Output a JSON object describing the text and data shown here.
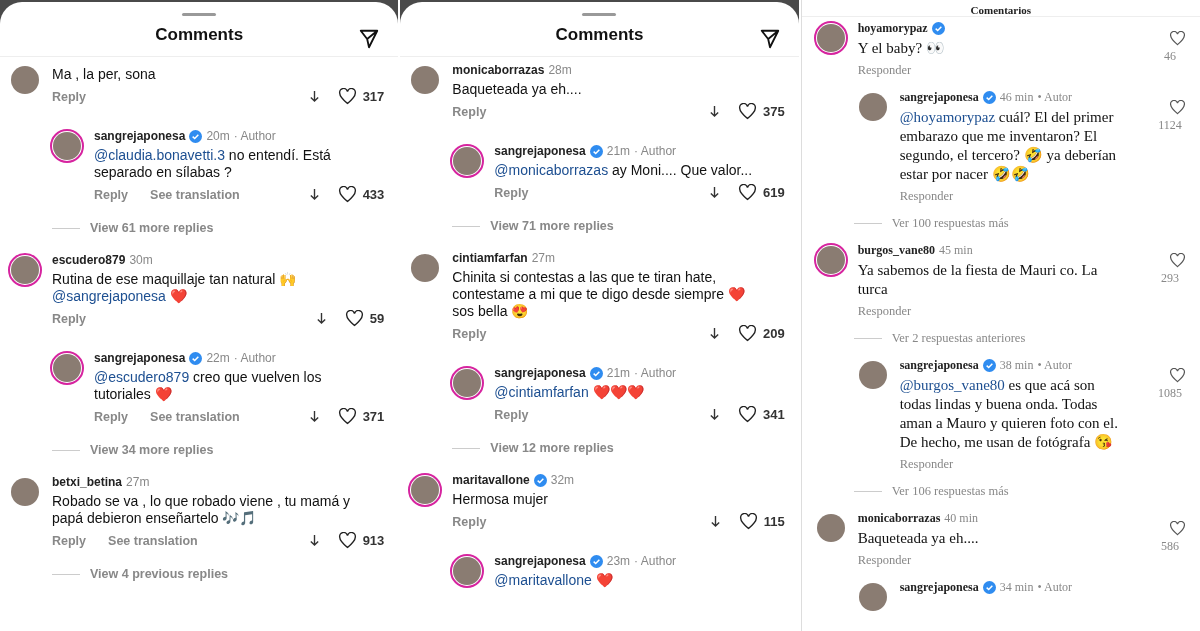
{
  "panels": [
    {
      "kind": "sheet",
      "title": "Comments",
      "items": [
        {
          "kind": "comment",
          "ring": false,
          "body": [
            {
              "kind": "plain",
              "text": "Ma , la per, sona"
            }
          ],
          "reply": "Reply",
          "likes": "317"
        },
        {
          "kind": "reply",
          "user": "sangrejaponesa",
          "verified": true,
          "ring": true,
          "time": "20m",
          "tag": "· Author",
          "body": [
            {
              "kind": "mention",
              "text": "@claudia.bonavetti.3"
            },
            {
              "kind": "plain",
              "text": " no entendí. Está separado en sílabas ?"
            }
          ],
          "reply": "Reply",
          "translate": "See translation",
          "likes": "433"
        },
        {
          "kind": "more",
          "text": "View 61 more replies"
        },
        {
          "kind": "comment",
          "user": "escudero879",
          "verified": false,
          "ring": true,
          "time": "30m",
          "body": [
            {
              "kind": "plain",
              "text": "Rutina de ese maquillaje tan natural 🙌 "
            },
            {
              "kind": "mention",
              "text": "@sangrejaponesa"
            },
            {
              "kind": "plain",
              "text": " ❤️"
            }
          ],
          "reply": "Reply",
          "likes": "59"
        },
        {
          "kind": "reply",
          "user": "sangrejaponesa",
          "verified": true,
          "ring": true,
          "time": "22m",
          "tag": "· Author",
          "body": [
            {
              "kind": "mention",
              "text": "@escudero879"
            },
            {
              "kind": "plain",
              "text": " creo que vuelven los tutoriales ❤️"
            }
          ],
          "reply": "Reply",
          "translate": "See translation",
          "likes": "371"
        },
        {
          "kind": "more",
          "text": "View 34 more replies"
        },
        {
          "kind": "comment",
          "user": "betxi_betina",
          "verified": false,
          "ring": false,
          "time": "27m",
          "body": [
            {
              "kind": "plain",
              "text": "Robado se va , lo que robado viene , tu mamá y papá debieron enseñartelo 🎶🎵"
            }
          ],
          "reply": "Reply",
          "translate": "See translation",
          "likes": "913"
        },
        {
          "kind": "more",
          "text": "View 4 previous replies"
        }
      ]
    },
    {
      "kind": "sheet",
      "title": "Comments",
      "items": [
        {
          "kind": "comment",
          "user": "monicaborrazas",
          "verified": false,
          "ring": false,
          "time": "28m",
          "body": [
            {
              "kind": "plain",
              "text": "Baqueteada ya eh...."
            }
          ],
          "reply": "Reply",
          "likes": "375"
        },
        {
          "kind": "reply",
          "user": "sangrejaponesa",
          "verified": true,
          "ring": true,
          "time": "21m",
          "tag": "· Author",
          "body": [
            {
              "kind": "mention",
              "text": "@monicaborrazas"
            },
            {
              "kind": "plain",
              "text": " ay Moni.... Que valor..."
            }
          ],
          "reply": "Reply",
          "likes": "619"
        },
        {
          "kind": "more",
          "text": "View 71 more replies"
        },
        {
          "kind": "comment",
          "user": "cintiamfarfan",
          "verified": false,
          "ring": false,
          "time": "27m",
          "body": [
            {
              "kind": "plain",
              "text": "Chinita si contestas a las que te tiran hate, contestame a mi que te digo desde siempre ❤️ sos bella 😍"
            }
          ],
          "reply": "Reply",
          "likes": "209"
        },
        {
          "kind": "reply",
          "user": "sangrejaponesa",
          "verified": true,
          "ring": true,
          "time": "21m",
          "tag": "· Author",
          "body": [
            {
              "kind": "mention",
              "text": "@cintiamfarfan"
            },
            {
              "kind": "plain",
              "text": " ❤️❤️❤️"
            }
          ],
          "reply": "Reply",
          "likes": "341"
        },
        {
          "kind": "more",
          "text": "View 12 more replies"
        },
        {
          "kind": "comment",
          "user": "maritavallone",
          "verified": true,
          "ring": true,
          "time": "32m",
          "body": [
            {
              "kind": "plain",
              "text": "Hermosa mujer"
            }
          ],
          "reply": "Reply",
          "likes": "115"
        },
        {
          "kind": "reply",
          "user": "sangrejaponesa",
          "verified": true,
          "ring": true,
          "time": "23m",
          "tag": "· Author",
          "body": [
            {
              "kind": "mention",
              "text": "@maritavallone"
            },
            {
              "kind": "plain",
              "text": " ❤️"
            }
          ]
        }
      ]
    },
    {
      "kind": "list",
      "title": "Comentarios",
      "items": [
        {
          "kind": "comment",
          "user": "hoyamorypaz",
          "verified": true,
          "ring": true,
          "body": [
            {
              "kind": "plain",
              "text": "Y el baby? 👀"
            }
          ],
          "reply": "Responder",
          "likes": "46"
        },
        {
          "kind": "reply",
          "user": "sangrejaponesa",
          "verified": true,
          "ring": false,
          "time": "46 min",
          "tag": "• Autor",
          "body": [
            {
              "kind": "mention",
              "text": "@hoyamorypaz"
            },
            {
              "kind": "plain",
              "text": " cuál? El del primer embarazo que me inventaron? El segundo, el tercero? 🤣 ya deberían estar por nacer 🤣🤣"
            }
          ],
          "reply": "Responder",
          "likes": "1124"
        },
        {
          "kind": "more",
          "text": "Ver 100 respuestas más"
        },
        {
          "kind": "comment",
          "user": "burgos_vane80",
          "verified": false,
          "ring": true,
          "time": "45 min",
          "body": [
            {
              "kind": "plain",
              "text": "Ya sabemos de la fiesta de Mauri co. La turca"
            }
          ],
          "reply": "Responder",
          "likes": "293"
        },
        {
          "kind": "more",
          "text": "Ver 2 respuestas anteriores"
        },
        {
          "kind": "reply",
          "user": "sangrejaponesa",
          "verified": true,
          "ring": false,
          "time": "38 min",
          "tag": "• Autor",
          "body": [
            {
              "kind": "mention",
              "text": "@burgos_vane80"
            },
            {
              "kind": "plain",
              "text": " es que acá son todas lindas y buena onda. Todas aman a Mauro y quieren foto con el. De hecho, me usan de fotógrafa 😘"
            }
          ],
          "reply": "Responder",
          "likes": "1085"
        },
        {
          "kind": "more",
          "text": "Ver 106 respuestas más"
        },
        {
          "kind": "comment",
          "user": "monicaborrazas",
          "verified": false,
          "ring": false,
          "time": "40 min",
          "body": [
            {
              "kind": "plain",
              "text": "Baqueteada ya eh...."
            }
          ],
          "reply": "Responder",
          "likes": "586"
        },
        {
          "kind": "reply",
          "user": "sangrejaponesa",
          "verified": true,
          "ring": false,
          "time": "34 min",
          "tag": "• Autor"
        }
      ]
    }
  ]
}
